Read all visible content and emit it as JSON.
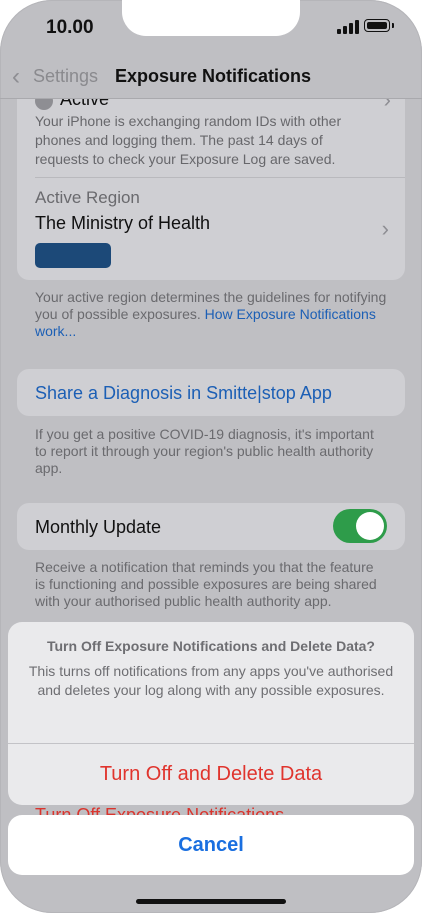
{
  "status_bar": {
    "time": "10.00"
  },
  "nav": {
    "back_label": "Settings",
    "title": "Exposure Notifications"
  },
  "active_section": {
    "status_label": "Active",
    "description": "Your iPhone is exchanging random IDs with other phones and logging them. The past 14 days of requests to check your Exposure Log are saved."
  },
  "region": {
    "label": "Active Region",
    "value": "The Ministry of Health",
    "footer": "Your active region determines the guidelines for notifying you of possible exposures.",
    "footer_link": "How Exposure Notifications work..."
  },
  "share": {
    "button_label": "Share a Diagnosis in Smitte|stop App",
    "footer": "If you get a positive COVID-19 diagnosis, it's important to report it through your region's public health authority app."
  },
  "monthly_update": {
    "label": "Monthly Update",
    "enabled": true,
    "footer": "Receive a notification that reminds you that the feature is functioning and possible exposures are being shared with your authorised public health authority app."
  },
  "behind_button": "Turn Off Exposure Notifications",
  "action_sheet": {
    "title": "Turn Off Exposure Notifications and Delete Data?",
    "message": "This turns off notifications from any apps you've authorised and deletes your log along with any possible exposures.",
    "destructive_action": "Turn Off and Delete Data",
    "cancel": "Cancel"
  },
  "colors": {
    "link": "#1c5fb5",
    "destructive": "#e0342d",
    "cancel": "#1a6fe0",
    "toggle_on": "#2e9c4a",
    "region_badge": "#1c4978"
  }
}
